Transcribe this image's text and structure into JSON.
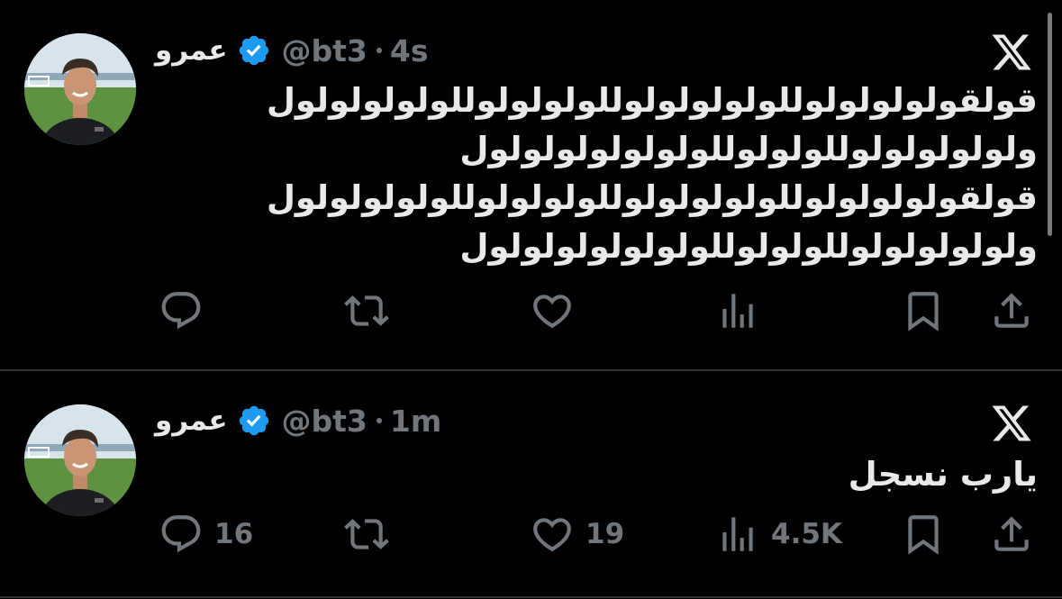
{
  "colors": {
    "background": "#000000",
    "text_primary": "#e7e9ea",
    "text_secondary": "#71767b",
    "verified_badge": "#1d9bf0",
    "divider": "#2f3336"
  },
  "tweets": [
    {
      "display_name": "عمرو",
      "handle": "@bt3",
      "time": "4s",
      "verified": true,
      "body_lines": [
        "قولقولولولولوللولولولولوللولولولوللولولولولول",
        "ولولولولولوللولولوللولولولولولولول",
        "قولقولولولولوللولولولولوللولولولوللولولولولول",
        "ولولولولولوللولولوللولولولولولولول"
      ],
      "actions": {
        "reply": "",
        "retweet": "",
        "like": "",
        "views": ""
      }
    },
    {
      "display_name": "عمرو",
      "handle": "@bt3",
      "time": "1m",
      "verified": true,
      "body_lines": [
        "يارب نسجل"
      ],
      "actions": {
        "reply": "16",
        "retweet": "",
        "like": "19",
        "views": "4.5K"
      }
    }
  ],
  "icons": [
    "reply-icon",
    "retweet-icon",
    "like-icon",
    "views-icon",
    "bookmark-icon",
    "share-icon",
    "x-logo-icon",
    "verified-badge-icon"
  ]
}
